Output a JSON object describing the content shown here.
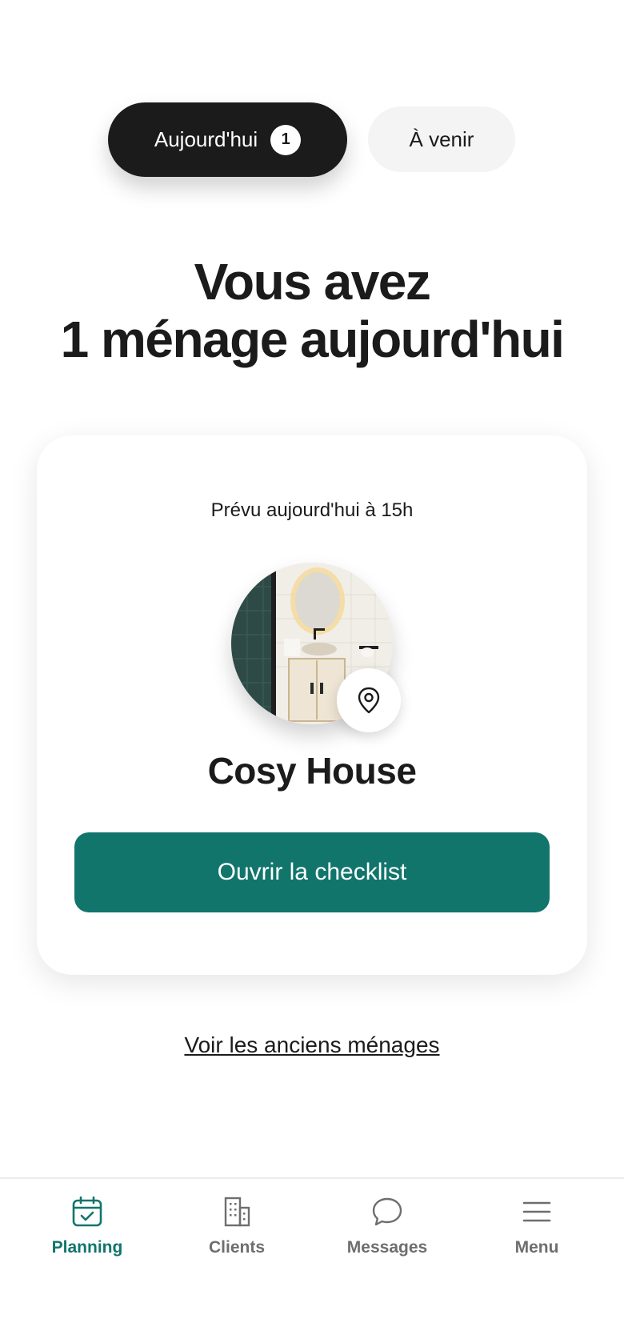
{
  "tabs": {
    "today_label": "Aujourd'hui",
    "today_count": "1",
    "upcoming_label": "À venir"
  },
  "heading": {
    "line1": "Vous avez",
    "line2": "1 ménage aujourd'hui"
  },
  "card": {
    "schedule": "Prévu aujourd'hui à 15h",
    "place_name": "Cosy House",
    "cta_label": "Ouvrir la checklist"
  },
  "past_link": "Voir les anciens ménages",
  "bottom_nav": {
    "planning": "Planning",
    "clients": "Clients",
    "messages": "Messages",
    "menu": "Menu"
  },
  "colors": {
    "accent": "#11756c",
    "dark": "#1b1b1b",
    "inactive": "#6e6e6e"
  }
}
